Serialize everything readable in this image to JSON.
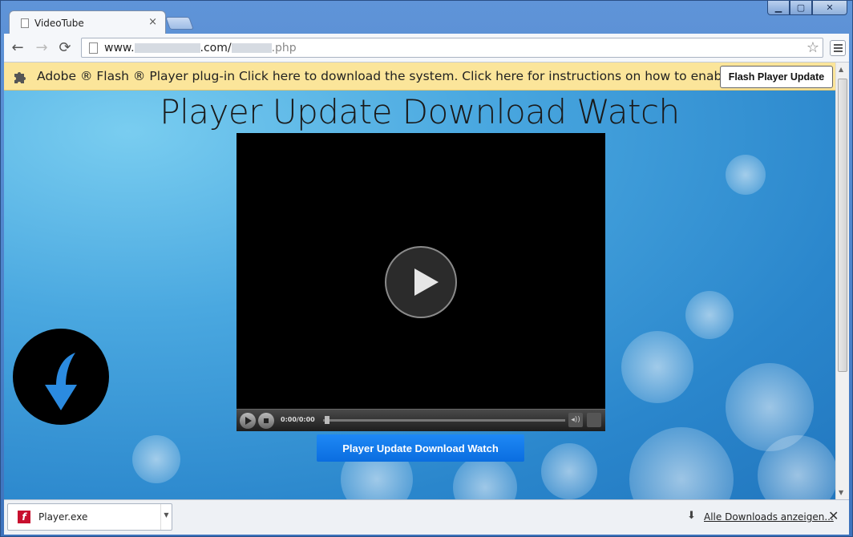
{
  "window": {
    "minimize_label": "▁",
    "maximize_label": "▢",
    "close_label": "✕"
  },
  "tab": {
    "title": "VideoTube",
    "close": "×"
  },
  "toolbar": {
    "back": "←",
    "forward": "→",
    "reload": "⟳",
    "url_prefix": "www.",
    "url_mid": ".com/",
    "url_suffix": ".php",
    "star": "☆"
  },
  "infobar": {
    "message": "Adobe ® Flash ® Player plug-in Click here to download the system. Click here for instructions on how to enable.",
    "button": "Flash Player Update"
  },
  "page": {
    "title": "Player Update Download Watch",
    "cta": "Player Update Download Watch"
  },
  "player": {
    "time": "0:00/0:00",
    "volume_icon": "◂))"
  },
  "downloads": {
    "file_name": "Player.exe",
    "flash_glyph": "f",
    "dropdown": "▼",
    "show_all": "Alle Downloads anzeigen...",
    "show_all_icon": "⬇",
    "close": "✕"
  },
  "colors": {
    "infobar_bg": "#fbe59a",
    "cta_blue": "#1e88f5",
    "frame_blue": "#4b80c6"
  }
}
